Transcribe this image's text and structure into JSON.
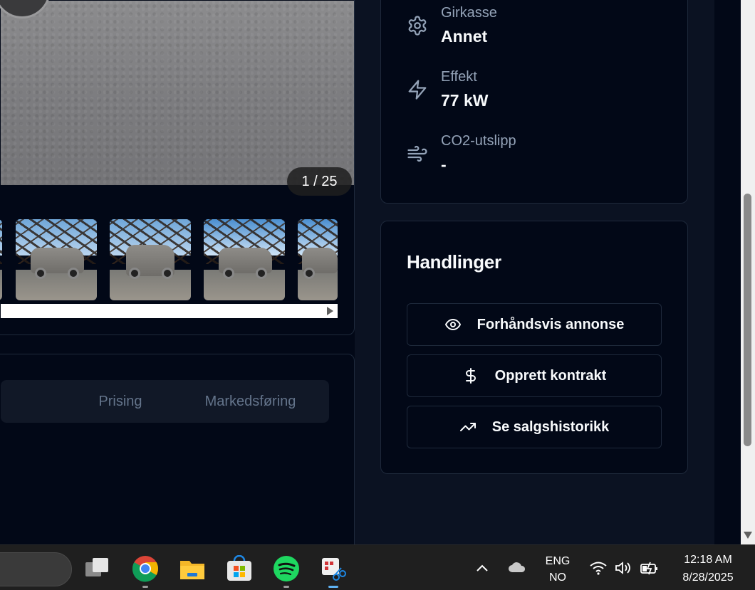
{
  "gallery": {
    "counter": "1 / 25"
  },
  "tabs": [
    {
      "label": "Prising"
    },
    {
      "label": "Markedsføring"
    }
  ],
  "specs": [
    {
      "icon": "gear-icon",
      "label": "Girkasse",
      "value": "Annet"
    },
    {
      "icon": "bolt-icon",
      "label": "Effekt",
      "value": "77 kW"
    },
    {
      "icon": "wind-icon",
      "label": "CO2-utslipp",
      "value": "-"
    }
  ],
  "actions": {
    "title": "Handlinger",
    "buttons": [
      {
        "icon": "eye-icon",
        "label": "Forhåndsvis annonse"
      },
      {
        "icon": "dollar-icon",
        "label": "Opprett kontrakt"
      },
      {
        "icon": "trending-up-icon",
        "label": "Se salgshistorikk"
      }
    ]
  },
  "taskbar": {
    "language_top": "ENG",
    "language_bottom": "NO",
    "time": "12:18 AM",
    "date": "8/28/2025"
  },
  "colors": {
    "background": "#020817",
    "card_border": "#1e293b",
    "muted_text": "#94a3b8",
    "tab_text": "#64748b"
  }
}
